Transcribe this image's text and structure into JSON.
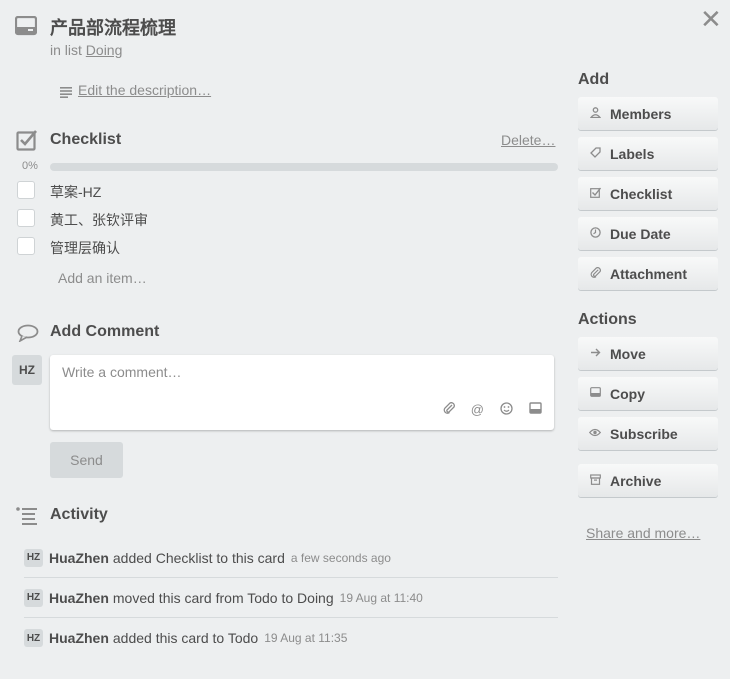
{
  "card": {
    "title": "产品部流程梳理",
    "in_list_prefix": "in list",
    "list_name": "Doing",
    "edit_description": "Edit the description…"
  },
  "checklist": {
    "title": "Checklist",
    "delete_label": "Delete…",
    "progress_text": "0%",
    "progress": 0,
    "items": [
      {
        "label": "草案-HZ",
        "checked": false
      },
      {
        "label": "黄工、张钦评审",
        "checked": false
      },
      {
        "label": "管理层确认",
        "checked": false
      }
    ],
    "add_item": "Add an item…"
  },
  "comment": {
    "title": "Add Comment",
    "avatar": "HZ",
    "placeholder": "Write a comment…",
    "send_label": "Send"
  },
  "activity": {
    "title": "Activity",
    "entries": [
      {
        "avatar": "HZ",
        "user": "HuaZhen",
        "text": "added Checklist to this card",
        "time": "a few seconds ago"
      },
      {
        "avatar": "HZ",
        "user": "HuaZhen",
        "text": "moved this card from Todo to Doing",
        "time": "19 Aug at 11:40"
      },
      {
        "avatar": "HZ",
        "user": "HuaZhen",
        "text": "added this card to Todo",
        "time": "19 Aug at 11:35"
      }
    ]
  },
  "sidebar": {
    "add_title": "Add",
    "add_buttons": [
      {
        "label": "Members",
        "icon": "person-icon"
      },
      {
        "label": "Labels",
        "icon": "tag-icon"
      },
      {
        "label": "Checklist",
        "icon": "checkbox-icon"
      },
      {
        "label": "Due Date",
        "icon": "clock-icon"
      },
      {
        "label": "Attachment",
        "icon": "paperclip-icon"
      }
    ],
    "actions_title": "Actions",
    "action_buttons": [
      {
        "label": "Move",
        "icon": "arrow-right-icon"
      },
      {
        "label": "Copy",
        "icon": "card-icon"
      },
      {
        "label": "Subscribe",
        "icon": "eye-icon"
      },
      {
        "label": "Archive",
        "icon": "archive-icon"
      }
    ],
    "share_label": "Share and more…"
  },
  "colors": {
    "background": "#edeff0",
    "text": "#4d4d4d",
    "muted": "#8c8c8c",
    "progress_track": "#d6dadc"
  }
}
